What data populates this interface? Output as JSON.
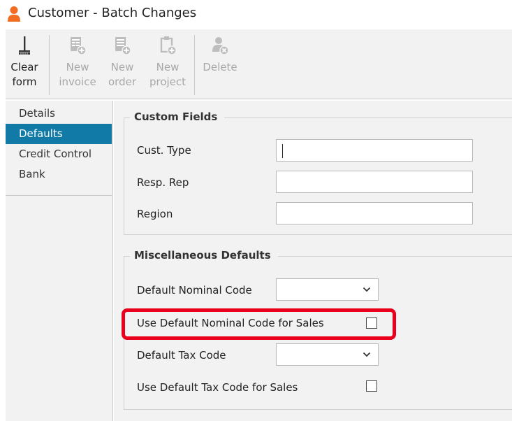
{
  "window": {
    "title": "Customer - Batch Changes",
    "app_icon": "person-icon",
    "accent_color": "#117aa6"
  },
  "toolbar": {
    "buttons": [
      {
        "label": "Clear form",
        "icon": "broom-icon",
        "enabled": true
      },
      {
        "label": "New invoice",
        "icon": "new-invoice-icon",
        "enabled": false
      },
      {
        "label": "New order",
        "icon": "new-order-icon",
        "enabled": false
      },
      {
        "label": "New project",
        "icon": "new-project-icon",
        "enabled": false
      },
      {
        "label": "Delete",
        "icon": "delete-user-icon",
        "enabled": false
      }
    ]
  },
  "nav": {
    "items": [
      {
        "label": "Details",
        "active": false
      },
      {
        "label": "Defaults",
        "active": true
      },
      {
        "label": "Credit Control",
        "active": false
      },
      {
        "label": "Bank",
        "active": false
      }
    ]
  },
  "custom_fields": {
    "title": "Custom Fields",
    "fields": [
      {
        "label": "Cust. Type",
        "value": ""
      },
      {
        "label": "Resp. Rep",
        "value": ""
      },
      {
        "label": "Region",
        "value": ""
      }
    ]
  },
  "misc_defaults": {
    "title": "Miscellaneous Defaults",
    "default_nominal_code": {
      "label": "Default Nominal Code",
      "value": ""
    },
    "use_default_nominal_for_sales": {
      "label": "Use Default Nominal Code for Sales",
      "checked": false
    },
    "default_tax_code": {
      "label": "Default Tax Code",
      "value": ""
    },
    "use_default_tax_for_sales": {
      "label": "Use Default Tax Code for Sales",
      "checked": false
    }
  },
  "highlight_color": "#e8001c"
}
